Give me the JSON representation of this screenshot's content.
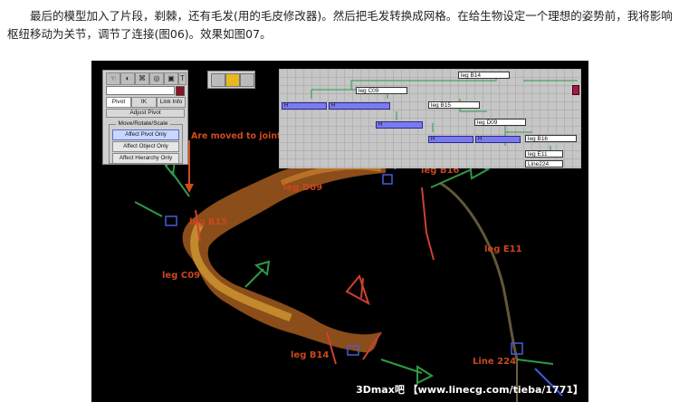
{
  "article": {
    "paragraph": "最后的模型加入了片段，剃棘，还有毛发(用的毛皮修改器)。然后把毛发转换成网格。在给生物设定一个理想的姿势前，我将影响枢纽移动为关节，调节了连接(图06)。效果如图07。"
  },
  "screenshot": {
    "annotation": "Are moved to joints",
    "leg_labels": {
      "b16": "leg B16",
      "d09": "leg D09",
      "b15": "leg B15",
      "e11": "leg E11",
      "c09": "leg C09",
      "b14": "leg B14",
      "line224": "Line 224"
    },
    "hierarchy_panel": {
      "tabs": [
        "Pivot",
        "IK",
        "Link Info"
      ],
      "section_title": "Adjust Pivot",
      "group_title": "Move/Rotate/Scale",
      "buttons": [
        "Affect Pivot Only",
        "Affect Object Only",
        "Affect Hierarchy Only"
      ],
      "active_button": "Affect Pivot Only"
    },
    "schematic": {
      "nodes": {
        "b14": "leg B14",
        "c09": "leg C09",
        "b15": "leg B15",
        "d09": "leg D09",
        "b16": "leg B16",
        "e11": "leg E11",
        "line224": "Line224"
      },
      "helper_label": "H"
    },
    "watermark": "3Dmax吧 【www.linecg.com/tieba/1771】"
  },
  "colors": {
    "label": "#c9471f",
    "schematic_blue": "#7b7bf0",
    "wire_green": "#2e9a46"
  }
}
